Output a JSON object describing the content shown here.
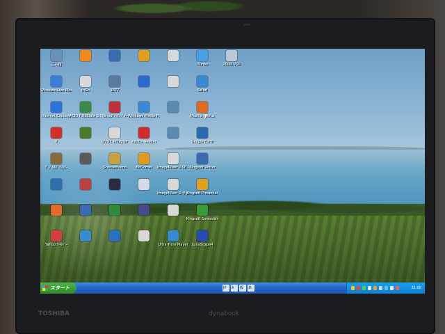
{
  "taskbar": {
    "start_label": "スタート",
    "clock": "21:00",
    "ime_items": [
      "JP",
      "A",
      "般",
      "あ"
    ]
  },
  "bezel": {
    "brand_left": "TOSHIBA",
    "brand_right": "dynabook"
  },
  "desktop_icons": [
    {
      "label": "ごみ箱",
      "color": "#6a8fb8",
      "icon": "recycle-bin-icon"
    },
    {
      "label": "Windows Live Messenger",
      "color": "#3b7fd4",
      "icon": "messenger-icon"
    },
    {
      "label": "Internet Explorer",
      "color": "#2d74d6",
      "icon": "ie-icon"
    },
    {
      "label": "R",
      "color": "#d0302a",
      "icon": "app-r-icon"
    },
    {
      "label": "ﾃﾞｼﾞﾀﾙﾀﾞｲﾚｸﾀｰ",
      "color": "#8a6b3a",
      "icon": "app-icon"
    },
    {
      "label": "",
      "color": "#2f6fb0",
      "icon": "app-icon"
    },
    {
      "label": "",
      "color": "#e06b2a",
      "icon": "app-icon"
    },
    {
      "label": "Yahoo!ﾂｰﾙﾊﾞｰ",
      "color": "#d04040",
      "icon": "yahoo-icon"
    },
    {
      "label": "",
      "color": "#f08a1a",
      "icon": "app-icon"
    },
    {
      "label": "mGo",
      "color": "#d8d8d8",
      "icon": "app-icon"
    },
    {
      "label": "ACID FotoSlate 3.0",
      "color": "#3c8a4a",
      "icon": "acid-icon"
    },
    {
      "label": "",
      "color": "#4a7a2a",
      "icon": "app-icon"
    },
    {
      "label": "",
      "color": "#5a5a5a",
      "icon": "app-icon"
    },
    {
      "label": "",
      "color": "#c04040",
      "icon": "app-icon"
    },
    {
      "label": "",
      "color": "#3a6ab0",
      "icon": "app-icon"
    },
    {
      "label": "",
      "color": "#3a8ad0",
      "icon": "app-icon"
    },
    {
      "label": "",
      "color": "#3a6ab0",
      "icon": "app-icon"
    },
    {
      "label": "1877",
      "color": "#5a7aa0",
      "icon": "app-icon"
    },
    {
      "label": "Yahoo!ﾒｯｾﾝｼﾞｬｰ",
      "color": "#c0303a",
      "icon": "app-icon"
    },
    {
      "label": "DVD Decrypter",
      "color": "#d8d8d8",
      "icon": "dvd-icon"
    },
    {
      "label": "Scoinadhomo",
      "color": "#c8a040",
      "icon": "app-icon"
    },
    {
      "label": "",
      "color": "#2a2a40",
      "icon": "app-icon"
    },
    {
      "label": "",
      "color": "#2f8a3a",
      "icon": "app-icon"
    },
    {
      "label": "",
      "color": "#2a70c0",
      "icon": "app-icon"
    },
    {
      "label": "",
      "color": "#e0a020",
      "icon": "folder-icon"
    },
    {
      "label": "",
      "color": "#2a6ad0",
      "icon": "app-icon"
    },
    {
      "label": "Windows Media Player",
      "color": "#3a8ad0",
      "icon": "wmp-icon"
    },
    {
      "label": "Adobe Reader",
      "color": "#d02a2a",
      "icon": "adobe-reader-icon"
    },
    {
      "label": "BitComet",
      "color": "#e09a20",
      "icon": "bitcomet-icon"
    },
    {
      "label": "",
      "color": "#d8d8e8",
      "icon": "app-icon"
    },
    {
      "label": "",
      "color": "#4a4a8a",
      "icon": "app-icon"
    },
    {
      "label": "",
      "color": "#d8d8d8",
      "icon": "app-icon"
    },
    {
      "label": "",
      "color": "#d8d8d8",
      "icon": "app-icon"
    },
    {
      "label": "",
      "color": "#d8d8d8",
      "icon": "app-icon"
    },
    {
      "label": "",
      "color": "#5a8ab0",
      "icon": "app-icon"
    },
    {
      "label": "",
      "color": "#5a8ab0",
      "icon": "app-icon"
    },
    {
      "label": "ImageMixer 3 SE Player",
      "color": "#d8d8d8",
      "icon": "imagemixer-icon"
    },
    {
      "label": "ImageMixer 3 サポートページ",
      "color": "#d8d8d8",
      "icon": "imagemixer-icon"
    },
    {
      "label": "",
      "color": "#d8d8d8",
      "icon": "app-icon"
    },
    {
      "label": "Ultra Time Player",
      "color": "#3a8ad0",
      "icon": "app-icon"
    },
    {
      "label": "iTunes",
      "color": "#4aa0e0",
      "icon": "itunes-icon"
    },
    {
      "label": "Safari",
      "color": "#3a8ad0",
      "icon": "safari-icon"
    },
    {
      "label": "Mozilla Firefox",
      "color": "#e06a20",
      "icon": "firefox-icon"
    },
    {
      "label": "Google Earth",
      "color": "#2a6ab0",
      "icon": "google-earth-icon"
    },
    {
      "label": "Kingsoft Writer",
      "color": "#3a6ab0",
      "icon": "app-icon"
    },
    {
      "label": "Kingsoft Presentation",
      "color": "#e0a020",
      "icon": "kingsoft-presentation-icon"
    },
    {
      "label": "Kingsoft Spreadsheets",
      "color": "#3a9a3a",
      "icon": "kingsoft-spreadsheets-icon"
    },
    {
      "label": "LunaScape4",
      "color": "#2a4ab0",
      "icon": "lunascape-icon"
    },
    {
      "label": "20080710",
      "color": "#b8c8d8",
      "icon": "file-icon"
    }
  ]
}
